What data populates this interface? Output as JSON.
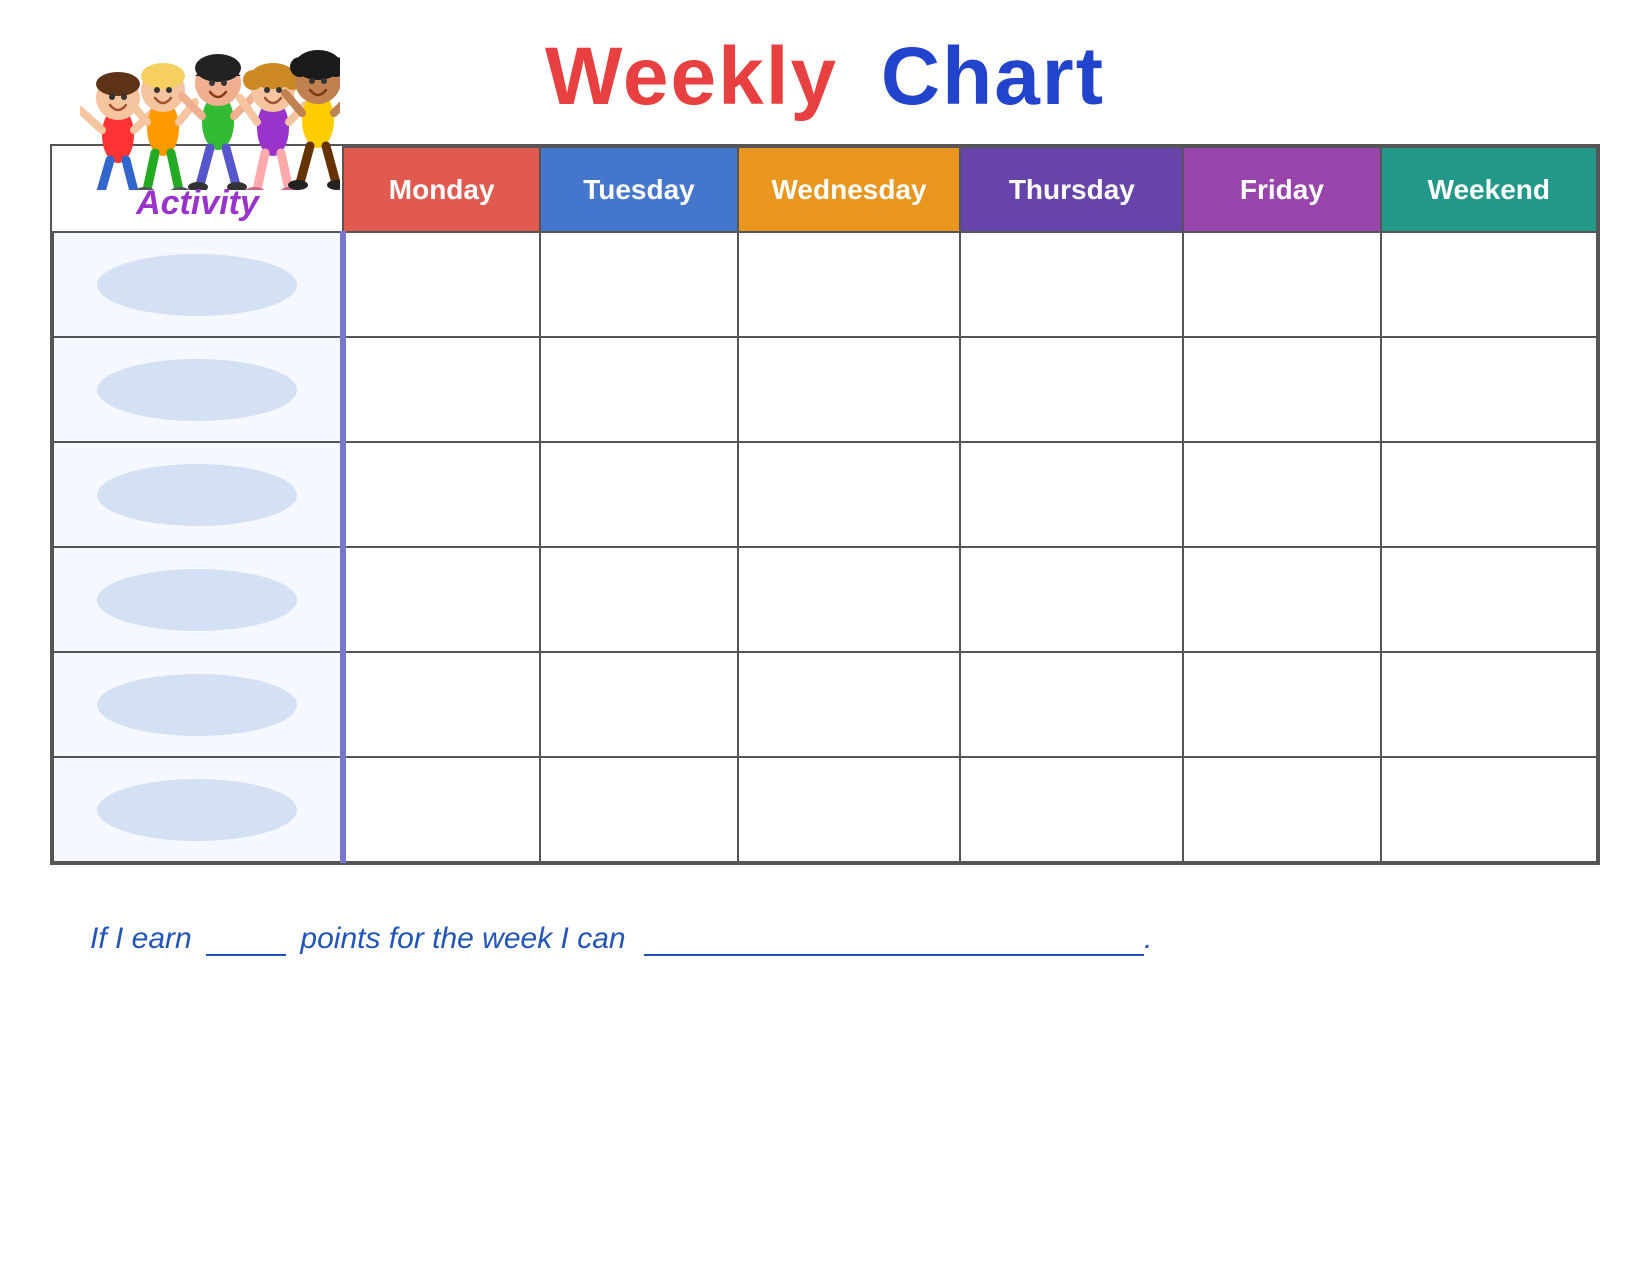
{
  "title": {
    "weekly": "Weekly",
    "chart": "Chart"
  },
  "activity_label": "Activity",
  "days": [
    "Monday",
    "Tuesday",
    "Wednesday",
    "Thursday",
    "Friday",
    "Weekend"
  ],
  "rows": [
    {
      "id": 1
    },
    {
      "id": 2
    },
    {
      "id": 3
    },
    {
      "id": 4
    },
    {
      "id": 5
    },
    {
      "id": 6
    }
  ],
  "footer": {
    "text_before_points": "If I earn",
    "text_after_points": "points for the week I can",
    "text_period": "."
  }
}
